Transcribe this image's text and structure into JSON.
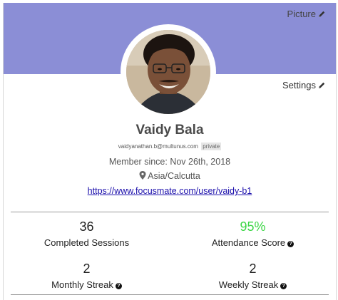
{
  "header": {
    "picture_label": "Picture",
    "settings_label": "Settings"
  },
  "profile": {
    "name": "Vaidy Bala",
    "email": "vaidyanathan.b@multunus.com",
    "email_visibility": "private",
    "member_since": "Member since: Nov 26th, 2018",
    "location": "Asia/Calcutta",
    "profile_url": "https://www.focusmate.com/user/vaidy-b1"
  },
  "stats": {
    "completed_sessions": {
      "value": "36",
      "label": "Completed Sessions"
    },
    "attendance_score": {
      "value": "95%",
      "label": "Attendance Score"
    },
    "monthly_streak": {
      "value": "2",
      "label": "Monthly Streak"
    },
    "weekly_streak": {
      "value": "2",
      "label": "Weekly Streak"
    }
  },
  "colors": {
    "banner": "#8b8ed6",
    "attendance_green": "#3cd646",
    "link": "#1a0dab"
  },
  "icons": {
    "edit": "pencil-icon",
    "location": "map-pin-icon",
    "help": "question-circle-icon"
  }
}
